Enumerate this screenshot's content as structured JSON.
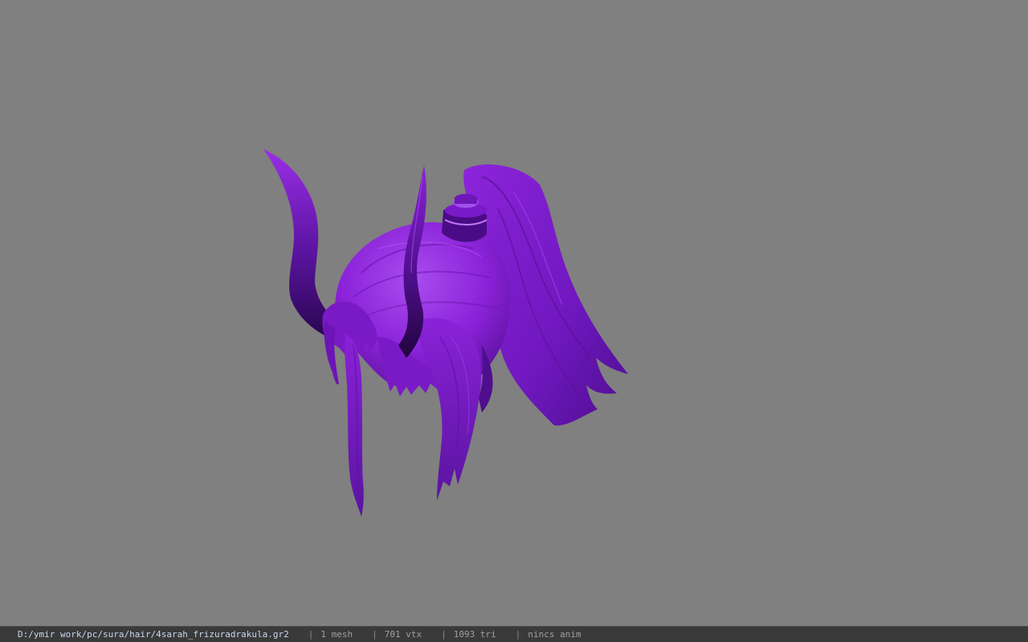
{
  "viewer": {
    "background_color": "#808080",
    "model": {
      "icon": "purple-hair-mesh",
      "color_primary": "#8a22d8",
      "color_dark": "#3e0a6e",
      "color_highlight": "#a94cf0"
    }
  },
  "statusbar": {
    "file_path": "D:/ymir work/pc/sura/hair/4sarah_frizuradrakula.gr2",
    "separator": "|",
    "mesh_count": "1 mesh",
    "vertex_count": "701 vtx",
    "triangle_count": "1093 tri",
    "animation": "nincs anim"
  }
}
